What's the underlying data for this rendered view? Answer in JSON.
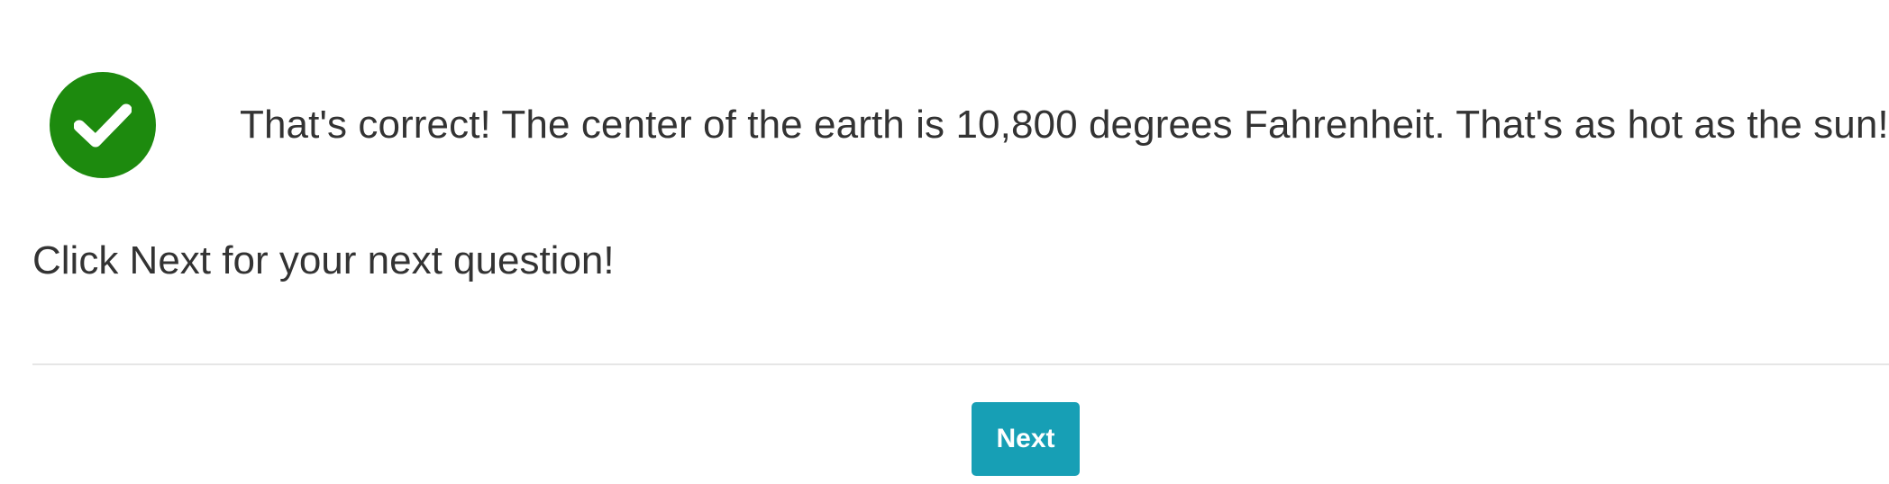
{
  "feedback": {
    "icon": "check-circle-icon",
    "icon_color": "#1d8a0e",
    "message": "That's correct! The center of the earth is 10,800 degrees Fahrenheit. That's as hot as the sun!"
  },
  "instruction": {
    "text": "Click Next for your next question!"
  },
  "actions": {
    "next_label": "Next",
    "next_color": "#179fb5"
  }
}
